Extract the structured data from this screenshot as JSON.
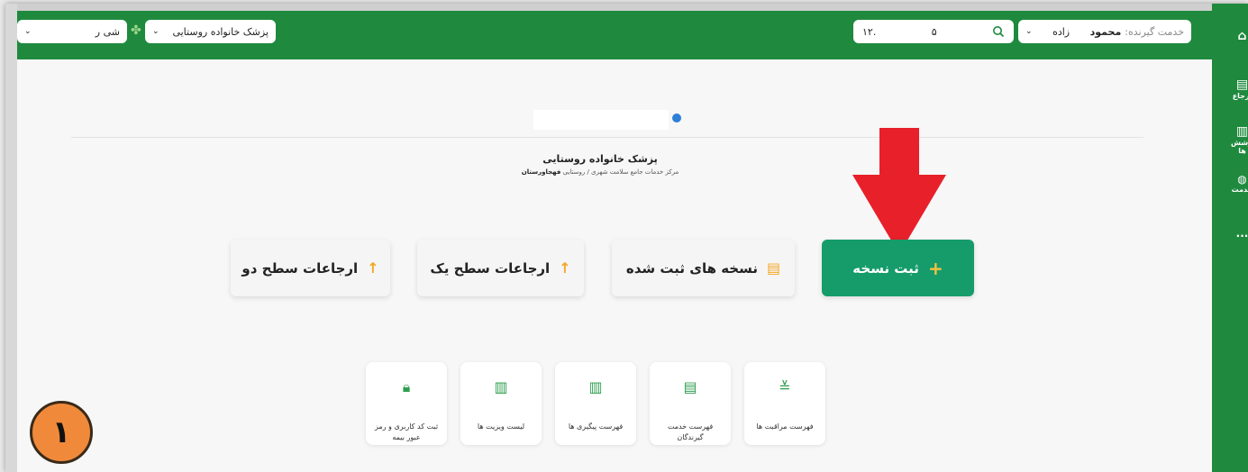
{
  "header": {
    "client_label": "خدمت گیرنده:",
    "client_name": "محمود",
    "client_family": "زاده",
    "search_value_a": "۱۲.",
    "search_value_b": "۵",
    "role_select": "پزشک خانواده روستایی",
    "location_select": "شی ر"
  },
  "profile": {
    "role_title": "پزشک خانواده روستایی",
    "center_path": "مرکز خدمات جامع سلامت شهری / روستایی",
    "center_name": "فهجاورستان"
  },
  "actions": [
    {
      "label": "ثبت نسخه"
    },
    {
      "label": "نسخه های ثبت شده"
    },
    {
      "label": "ارجاعات سطح یک"
    },
    {
      "label": "ارجاعات سطح دو"
    }
  ],
  "cards": [
    {
      "label": "فهرست مراقبت ها"
    },
    {
      "label": "فهرست خدمت گیرندگان"
    },
    {
      "label": "فهرست پیگیری ها"
    },
    {
      "label": "لیست ویزیت ها"
    },
    {
      "label": "ثبت کد کاربری و رمز عبور بیمه"
    }
  ],
  "rail": {
    "item1": "ارجاع",
    "item2": "پوشش ها",
    "item3": "خدمت",
    "more": "..."
  },
  "badge": {
    "number": "۱"
  },
  "colors": {
    "primary": "#1f8a3e",
    "accent_button": "#169c6a",
    "arrow_red": "#e8202a",
    "badge_orange": "#f08a3a",
    "icon_green": "#2e9e4f",
    "icon_orange": "#f5a623"
  }
}
